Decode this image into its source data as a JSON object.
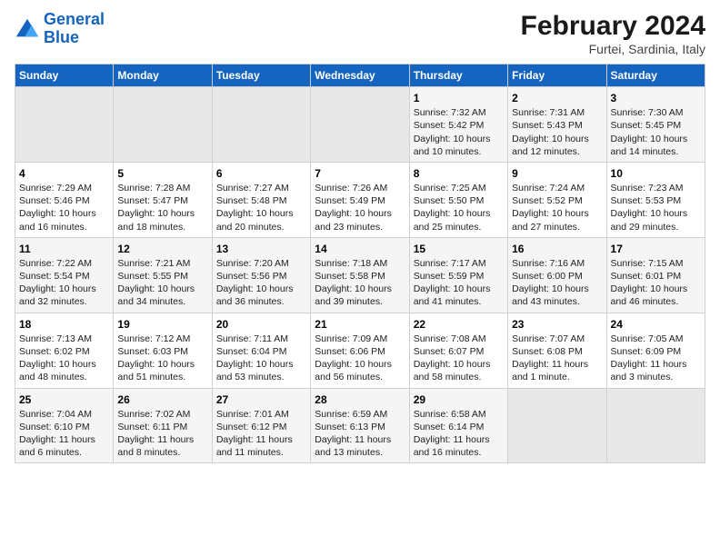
{
  "header": {
    "logo_line1": "General",
    "logo_line2": "Blue",
    "main_title": "February 2024",
    "subtitle": "Furtei, Sardinia, Italy"
  },
  "days_of_week": [
    "Sunday",
    "Monday",
    "Tuesday",
    "Wednesday",
    "Thursday",
    "Friday",
    "Saturday"
  ],
  "weeks": [
    [
      {
        "day": "",
        "info": ""
      },
      {
        "day": "",
        "info": ""
      },
      {
        "day": "",
        "info": ""
      },
      {
        "day": "",
        "info": ""
      },
      {
        "day": "1",
        "info": "Sunrise: 7:32 AM\nSunset: 5:42 PM\nDaylight: 10 hours\nand 10 minutes."
      },
      {
        "day": "2",
        "info": "Sunrise: 7:31 AM\nSunset: 5:43 PM\nDaylight: 10 hours\nand 12 minutes."
      },
      {
        "day": "3",
        "info": "Sunrise: 7:30 AM\nSunset: 5:45 PM\nDaylight: 10 hours\nand 14 minutes."
      }
    ],
    [
      {
        "day": "4",
        "info": "Sunrise: 7:29 AM\nSunset: 5:46 PM\nDaylight: 10 hours\nand 16 minutes."
      },
      {
        "day": "5",
        "info": "Sunrise: 7:28 AM\nSunset: 5:47 PM\nDaylight: 10 hours\nand 18 minutes."
      },
      {
        "day": "6",
        "info": "Sunrise: 7:27 AM\nSunset: 5:48 PM\nDaylight: 10 hours\nand 20 minutes."
      },
      {
        "day": "7",
        "info": "Sunrise: 7:26 AM\nSunset: 5:49 PM\nDaylight: 10 hours\nand 23 minutes."
      },
      {
        "day": "8",
        "info": "Sunrise: 7:25 AM\nSunset: 5:50 PM\nDaylight: 10 hours\nand 25 minutes."
      },
      {
        "day": "9",
        "info": "Sunrise: 7:24 AM\nSunset: 5:52 PM\nDaylight: 10 hours\nand 27 minutes."
      },
      {
        "day": "10",
        "info": "Sunrise: 7:23 AM\nSunset: 5:53 PM\nDaylight: 10 hours\nand 29 minutes."
      }
    ],
    [
      {
        "day": "11",
        "info": "Sunrise: 7:22 AM\nSunset: 5:54 PM\nDaylight: 10 hours\nand 32 minutes."
      },
      {
        "day": "12",
        "info": "Sunrise: 7:21 AM\nSunset: 5:55 PM\nDaylight: 10 hours\nand 34 minutes."
      },
      {
        "day": "13",
        "info": "Sunrise: 7:20 AM\nSunset: 5:56 PM\nDaylight: 10 hours\nand 36 minutes."
      },
      {
        "day": "14",
        "info": "Sunrise: 7:18 AM\nSunset: 5:58 PM\nDaylight: 10 hours\nand 39 minutes."
      },
      {
        "day": "15",
        "info": "Sunrise: 7:17 AM\nSunset: 5:59 PM\nDaylight: 10 hours\nand 41 minutes."
      },
      {
        "day": "16",
        "info": "Sunrise: 7:16 AM\nSunset: 6:00 PM\nDaylight: 10 hours\nand 43 minutes."
      },
      {
        "day": "17",
        "info": "Sunrise: 7:15 AM\nSunset: 6:01 PM\nDaylight: 10 hours\nand 46 minutes."
      }
    ],
    [
      {
        "day": "18",
        "info": "Sunrise: 7:13 AM\nSunset: 6:02 PM\nDaylight: 10 hours\nand 48 minutes."
      },
      {
        "day": "19",
        "info": "Sunrise: 7:12 AM\nSunset: 6:03 PM\nDaylight: 10 hours\nand 51 minutes."
      },
      {
        "day": "20",
        "info": "Sunrise: 7:11 AM\nSunset: 6:04 PM\nDaylight: 10 hours\nand 53 minutes."
      },
      {
        "day": "21",
        "info": "Sunrise: 7:09 AM\nSunset: 6:06 PM\nDaylight: 10 hours\nand 56 minutes."
      },
      {
        "day": "22",
        "info": "Sunrise: 7:08 AM\nSunset: 6:07 PM\nDaylight: 10 hours\nand 58 minutes."
      },
      {
        "day": "23",
        "info": "Sunrise: 7:07 AM\nSunset: 6:08 PM\nDaylight: 11 hours\nand 1 minute."
      },
      {
        "day": "24",
        "info": "Sunrise: 7:05 AM\nSunset: 6:09 PM\nDaylight: 11 hours\nand 3 minutes."
      }
    ],
    [
      {
        "day": "25",
        "info": "Sunrise: 7:04 AM\nSunset: 6:10 PM\nDaylight: 11 hours\nand 6 minutes."
      },
      {
        "day": "26",
        "info": "Sunrise: 7:02 AM\nSunset: 6:11 PM\nDaylight: 11 hours\nand 8 minutes."
      },
      {
        "day": "27",
        "info": "Sunrise: 7:01 AM\nSunset: 6:12 PM\nDaylight: 11 hours\nand 11 minutes."
      },
      {
        "day": "28",
        "info": "Sunrise: 6:59 AM\nSunset: 6:13 PM\nDaylight: 11 hours\nand 13 minutes."
      },
      {
        "day": "29",
        "info": "Sunrise: 6:58 AM\nSunset: 6:14 PM\nDaylight: 11 hours\nand 16 minutes."
      },
      {
        "day": "",
        "info": ""
      },
      {
        "day": "",
        "info": ""
      }
    ]
  ]
}
